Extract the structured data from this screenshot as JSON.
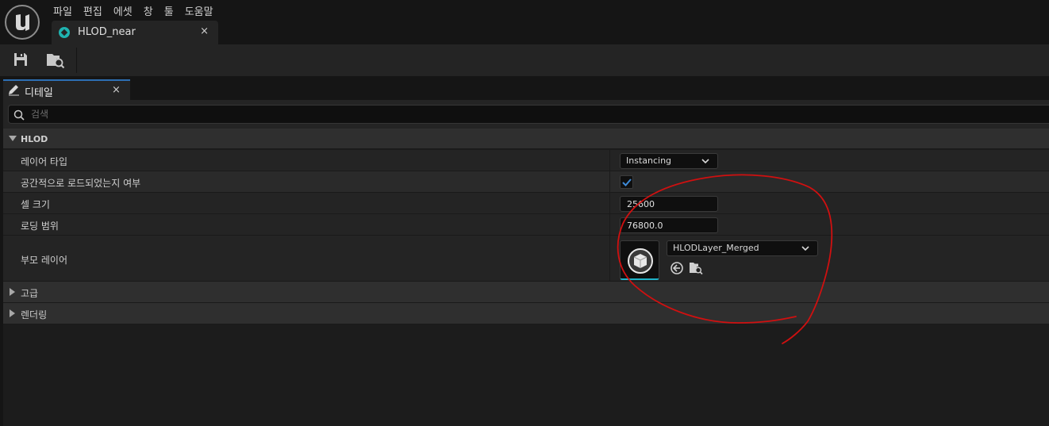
{
  "menubar": {
    "items": [
      "파일",
      "편집",
      "에셋",
      "창",
      "툴",
      "도움말"
    ]
  },
  "document_tab": {
    "label": "HLOD_near",
    "close": "×",
    "icon": "hlod-layer-icon"
  },
  "toolbar": {
    "save_icon": "save-icon",
    "browse_icon": "browse-folder-icon"
  },
  "details_panel": {
    "tab_label": "디테일",
    "tab_close": "×",
    "search_placeholder": "검색"
  },
  "categories": {
    "hlod": "HLOD",
    "advanced": "고급",
    "rendering": "렌더링"
  },
  "properties": {
    "layer_type": {
      "label": "레이어 타입",
      "value": "Instancing"
    },
    "spatially_loaded": {
      "label": "공간적으로 로드되었는지 여부",
      "checked": true
    },
    "cell_size": {
      "label": "셀 크기",
      "value": "25600"
    },
    "loading_range": {
      "label": "로딩 범위",
      "value": "76800.0"
    },
    "parent_layer": {
      "label": "부모 레이어",
      "value": "HLODLayer_Merged"
    }
  },
  "colors": {
    "accent_teal": "#1fb3b0",
    "checkbox_blue": "#3d8bd9",
    "annotation_red": "#d01010"
  }
}
